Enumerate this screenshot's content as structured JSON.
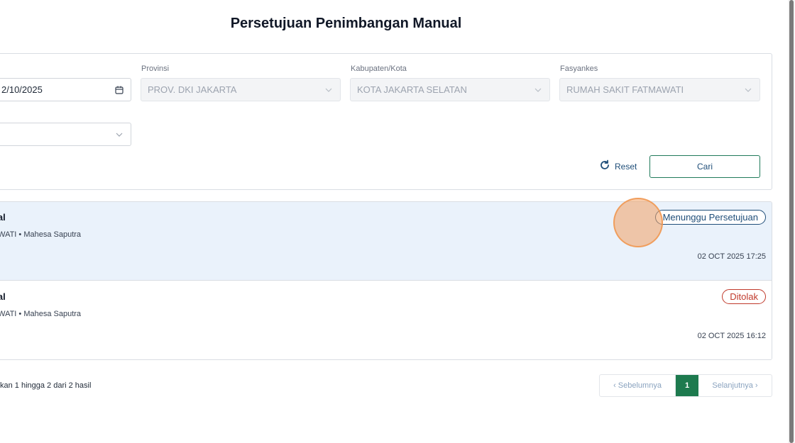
{
  "page": {
    "title": "Persetujuan Penimbangan Manual"
  },
  "filters": {
    "date": {
      "value": "2/10/2025"
    },
    "provinsi": {
      "label": "Provinsi",
      "value": "PROV. DKI JAKARTA"
    },
    "kabupaten": {
      "label": "Kabupaten/Kota",
      "value": "KOTA JAKARTA SELATAN"
    },
    "fasyankes": {
      "label": "Fasyankes",
      "value": "RUMAH SAKIT FATMAWATI"
    },
    "second_select": {
      "value": ""
    },
    "reset_label": "Reset",
    "search_label": "Cari"
  },
  "list": {
    "items": [
      {
        "title": "nual",
        "subtitle": "MAWATI • Mahesa Saputra",
        "status": "Menunggu Persetujuan",
        "status_type": "pending",
        "timestamp": "02 OCT 2025 17:25"
      },
      {
        "title": "nual",
        "subtitle": "MAWATI • Mahesa Saputra",
        "status": "Ditolak",
        "status_type": "rejected",
        "timestamp": "02 OCT 2025 16:12"
      }
    ]
  },
  "pagination": {
    "summary": "kan 1 hingga 2 dari 2 hasil",
    "prev_label": "‹  Sebelumnya",
    "current_page": "1",
    "next_label": "Selanjutnya  ›"
  },
  "colors": {
    "accent_green": "#1d7a4e",
    "link_blue": "#1f4e79",
    "selected_row": "#eaf2fb",
    "rejected_red": "#c0392b"
  },
  "icons": {
    "calendar": "calendar-icon",
    "chevron": "chevron-down-icon",
    "reset": "refresh-icon"
  }
}
